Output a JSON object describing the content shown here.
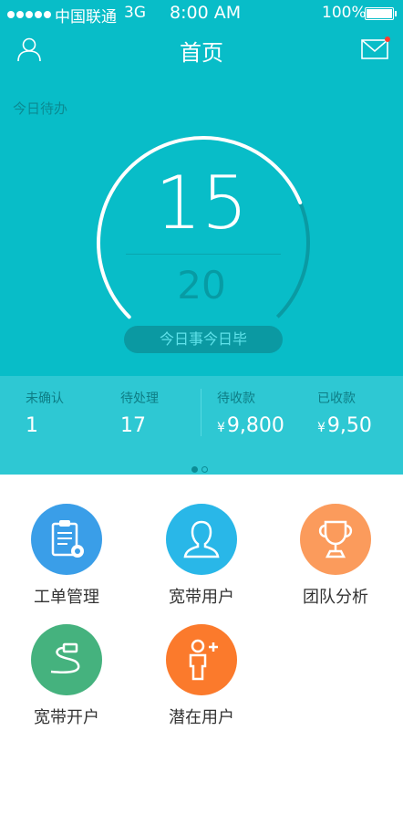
{
  "status_bar": {
    "carrier": "中国联通",
    "network": "3G",
    "time": "8:00 AM",
    "battery": "100%"
  },
  "header": {
    "title": "首页",
    "left_icon": "user-icon",
    "right_icon": "mail-icon",
    "has_unread_dot": true
  },
  "today": {
    "label": "今日待办",
    "done_count": "15",
    "total_count": "20",
    "progress_fraction": 0.75,
    "slogan": "今日事今日毕"
  },
  "stats": [
    {
      "label": "未确认",
      "value": "1",
      "currency": "",
      "has_chevron": true
    },
    {
      "label": "待处理",
      "value": "17",
      "currency": "",
      "has_chevron": true
    },
    {
      "label": "待收款",
      "value": "9,800",
      "currency": "¥",
      "has_chevron": false
    },
    {
      "label": "已收款",
      "value": "9,50",
      "currency": "¥",
      "has_chevron": false
    }
  ],
  "pager": {
    "current": 1,
    "total": 2
  },
  "menu": [
    {
      "label": "工单管理",
      "icon": "clipboard-gear-icon",
      "color": "#3a9ee8"
    },
    {
      "label": "宽带用户",
      "icon": "person-bust-icon",
      "color": "#29b7e8"
    },
    {
      "label": "团队分析",
      "icon": "trophy-icon",
      "color": "#fb9b5c"
    },
    {
      "label": "宽带开户",
      "icon": "cable-icon",
      "color": "#45b27e"
    },
    {
      "label": "潜在用户",
      "icon": "person-add-icon",
      "color": "#fb7a2c"
    }
  ],
  "colors": {
    "header_bg": "#08bdc8",
    "stats_bg": "#2ec8d3",
    "ring_track": "#0a9aa3",
    "unread_dot": "#ff3b30"
  }
}
